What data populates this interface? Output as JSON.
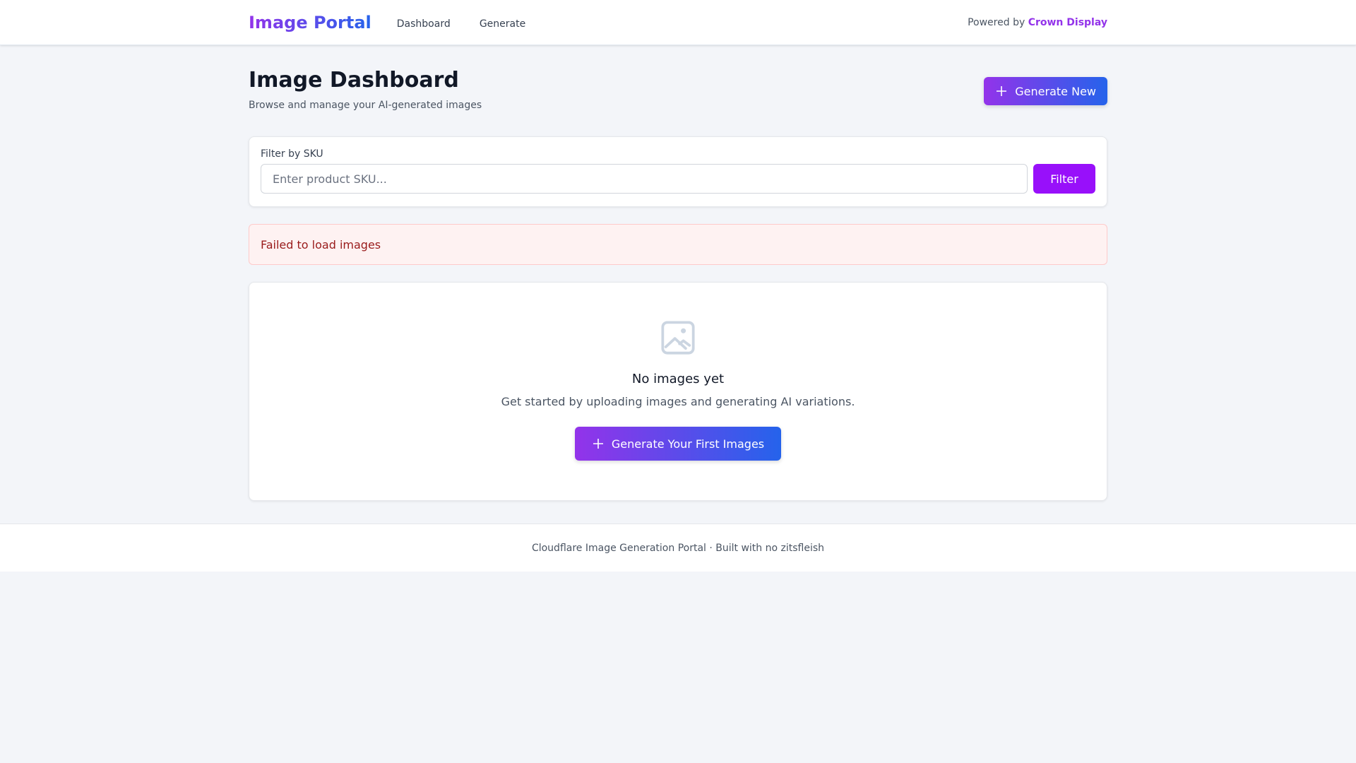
{
  "header": {
    "logo": "Image Portal",
    "nav": [
      "Dashboard",
      "Generate"
    ],
    "powered_prefix": "Powered by",
    "powered_brand": "Crown Display"
  },
  "page": {
    "title": "Image Dashboard",
    "subtitle": "Browse and manage your AI-generated images",
    "generate_new": "Generate New"
  },
  "filter": {
    "label": "Filter by SKU",
    "placeholder": "Enter product SKU...",
    "value": "",
    "button": "Filter"
  },
  "error": "Failed to load images",
  "empty": {
    "title": "No images yet",
    "description": "Get started by uploading images and generating AI variations.",
    "button": "Generate Your First Images"
  },
  "footer": "Cloudflare Image Generation Portal · Built with no zitsfleish",
  "colors": {
    "brand_start": "#9333ea",
    "brand_end": "#2563eb",
    "error_text": "#991b1b"
  }
}
